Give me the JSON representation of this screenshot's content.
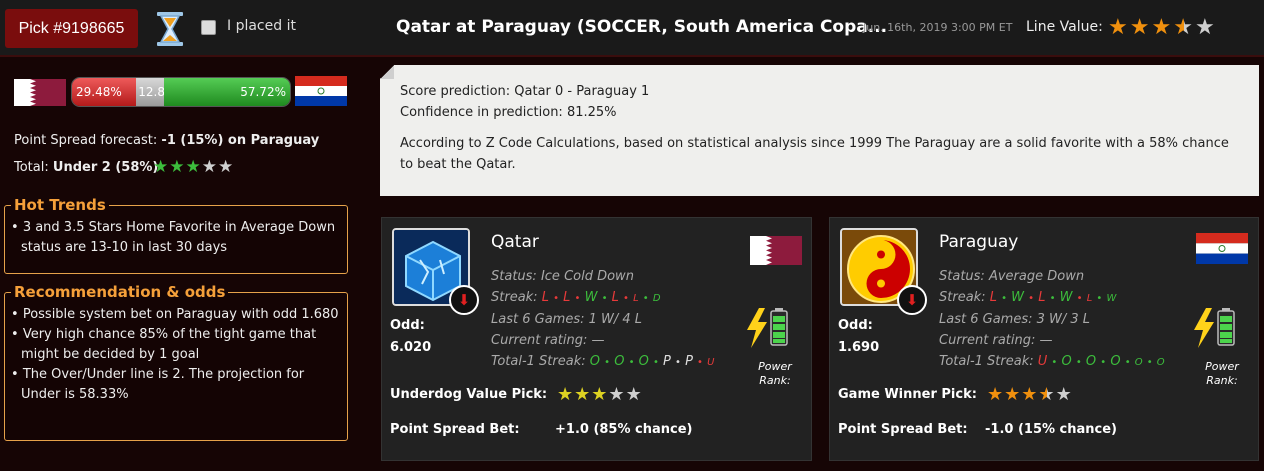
{
  "header": {
    "pick_label": "Pick #9198665",
    "placed_label": "I placed it",
    "game_title": "Qatar at Paraguay (SOCCER, South America Copa...",
    "game_date": "Jun. 16th, 2019 3:00 PM ET",
    "line_value_label": "Line Value:",
    "line_value_stars": 3.5,
    "icon": "hourglass-icon"
  },
  "probability_bar": {
    "away_pct": "29.48%",
    "draw_pct": "12.80%",
    "home_pct": "57.72%"
  },
  "forecast": {
    "ps_prefix": "Point Spread forecast:",
    "ps_value": "-1 (15%) on Paraguay",
    "total_prefix": "Total:",
    "total_value": "Under 2 (58%)",
    "total_stars": 3
  },
  "hot_trends": {
    "title": "Hot Trends",
    "items": [
      "3 and 3.5 Stars Home Favorite in Average Down status are 13-10 in last 30 days"
    ]
  },
  "recommendation": {
    "title": "Recommendation & odds",
    "items": [
      "Possible system bet on Paraguay with odd 1.680",
      "Very high chance 85% of the tight game that might be decided by 1 goal",
      "The Over/Under line is 2. The projection for Under is 58.33%"
    ]
  },
  "prediction": {
    "line1": "Score prediction: Qatar 0 - Paraguay 1",
    "line2": "Confidence in prediction: 81.25%",
    "paragraph": "According to Z Code Calculations, based on statistical analysis since 1999 The Paraguay are a solid favorite with a 58% chance to beat the Qatar."
  },
  "teams": {
    "qatar": {
      "name": "Qatar",
      "status_label": "Status:",
      "status": "Ice Cold Down",
      "streak_label": "Streak:",
      "last6_label": "Last 6 Games:",
      "last6": "1 W/ 4 L",
      "rating_label": "Current rating:",
      "rating": "—",
      "total_label": "Total-1 Streak:",
      "odd_label": "Odd:",
      "odd": "6.020",
      "power_label": "Power Rank:",
      "pick_label": "Underdog Value Pick:",
      "pick_stars": 3,
      "spread_label": "Point Spread Bet:",
      "spread": "+1.0 (85% chance)"
    },
    "paraguay": {
      "name": "Paraguay",
      "status_label": "Status:",
      "status": "Average Down",
      "streak_label": "Streak:",
      "last6_label": "Last 6 Games:",
      "last6": "3 W/ 3 L",
      "rating_label": "Current rating:",
      "rating": "—",
      "total_label": "Total-1 Streak:",
      "odd_label": "Odd:",
      "odd": "1.690",
      "power_label": "Power Rank:",
      "pick_label": "Game Winner Pick:",
      "pick_stars": 3.5,
      "spread_label": "Point Spread Bet:",
      "spread": "-1.0 (15% chance)"
    }
  },
  "colors": {
    "accent": "#7a0d0d",
    "orange": "#f0900e",
    "green": "#3cbd3c",
    "red": "#e83a3a"
  }
}
